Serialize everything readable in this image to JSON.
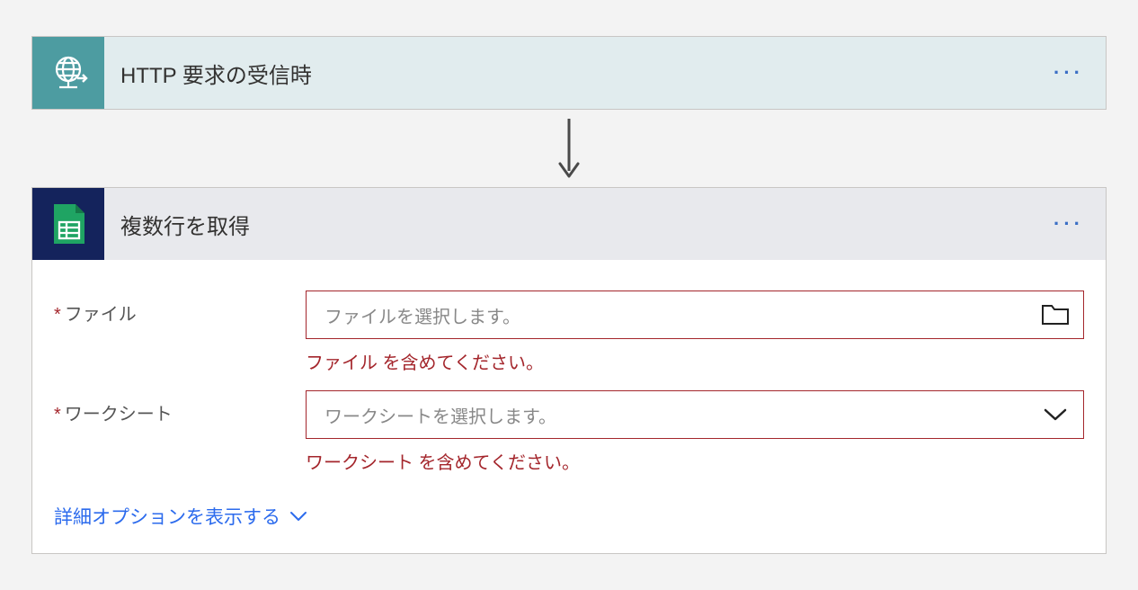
{
  "card1": {
    "title": "HTTP 要求の受信時"
  },
  "card2": {
    "title": "複数行を取得",
    "file": {
      "label": "ファイル",
      "placeholder": "ファイルを選択します。",
      "error": "ファイル を含めてください。"
    },
    "worksheet": {
      "label": "ワークシート",
      "placeholder": "ワークシートを選択します。",
      "error": "ワークシート を含めてください。"
    },
    "advanced": "詳細オプションを表示する"
  }
}
